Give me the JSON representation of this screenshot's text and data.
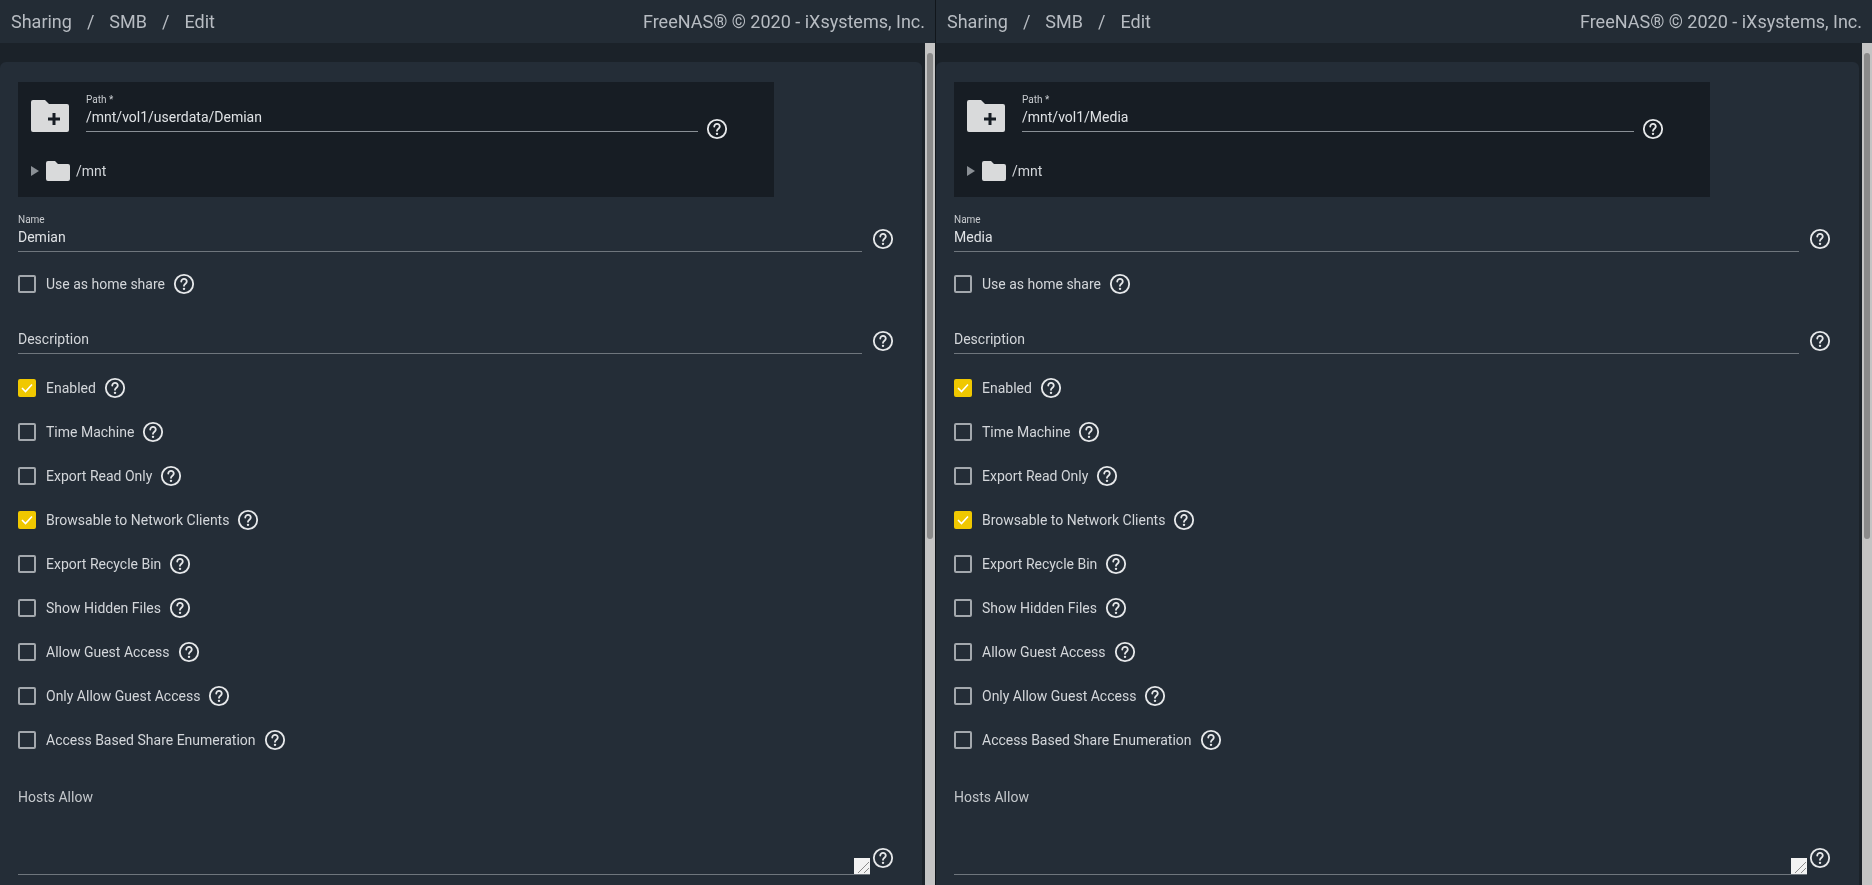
{
  "panes": [
    {
      "breadcrumb": [
        "Sharing",
        "SMB",
        "Edit"
      ],
      "breadcrumb_separators": [
        "/",
        "/"
      ],
      "copyright": "FreeNAS® © 2020 - iXsystems, Inc.",
      "path": {
        "label": "Path *",
        "value": "/mnt/vol1/userdata/Demian",
        "tree": [
          {
            "label": "/mnt",
            "expanded": false
          }
        ]
      },
      "name": {
        "label": "Name",
        "value": "Demian"
      },
      "home_share": {
        "label": "Use as home share",
        "checked": false
      },
      "description": {
        "placeholder": "Description"
      },
      "options": [
        {
          "label": "Enabled",
          "checked": true
        },
        {
          "label": "Time Machine",
          "checked": false
        },
        {
          "label": "Export Read Only",
          "checked": false
        },
        {
          "label": "Browsable to Network Clients",
          "checked": true
        },
        {
          "label": "Export Recycle Bin",
          "checked": false
        },
        {
          "label": "Show Hidden Files",
          "checked": false
        },
        {
          "label": "Allow Guest Access",
          "checked": false
        },
        {
          "label": "Only Allow Guest Access",
          "checked": false
        },
        {
          "label": "Access Based Share Enumeration",
          "checked": false
        }
      ],
      "hosts_allow": {
        "label": "Hosts Allow"
      }
    },
    {
      "breadcrumb": [
        "Sharing",
        "SMB",
        "Edit"
      ],
      "breadcrumb_separators": [
        "/",
        "/"
      ],
      "copyright": "FreeNAS® © 2020 - iXsystems, Inc.",
      "path": {
        "label": "Path *",
        "value": "/mnt/vol1/Media",
        "tree": [
          {
            "label": "/mnt",
            "expanded": false
          }
        ]
      },
      "name": {
        "label": "Name",
        "value": "Media"
      },
      "home_share": {
        "label": "Use as home share",
        "checked": false
      },
      "description": {
        "placeholder": "Description"
      },
      "options": [
        {
          "label": "Enabled",
          "checked": true
        },
        {
          "label": "Time Machine",
          "checked": false
        },
        {
          "label": "Export Read Only",
          "checked": false
        },
        {
          "label": "Browsable to Network Clients",
          "checked": true
        },
        {
          "label": "Export Recycle Bin",
          "checked": false
        },
        {
          "label": "Show Hidden Files",
          "checked": false
        },
        {
          "label": "Allow Guest Access",
          "checked": false
        },
        {
          "label": "Only Allow Guest Access",
          "checked": false
        },
        {
          "label": "Access Based Share Enumeration",
          "checked": false
        }
      ],
      "hosts_allow": {
        "label": "Hosts Allow"
      }
    }
  ]
}
